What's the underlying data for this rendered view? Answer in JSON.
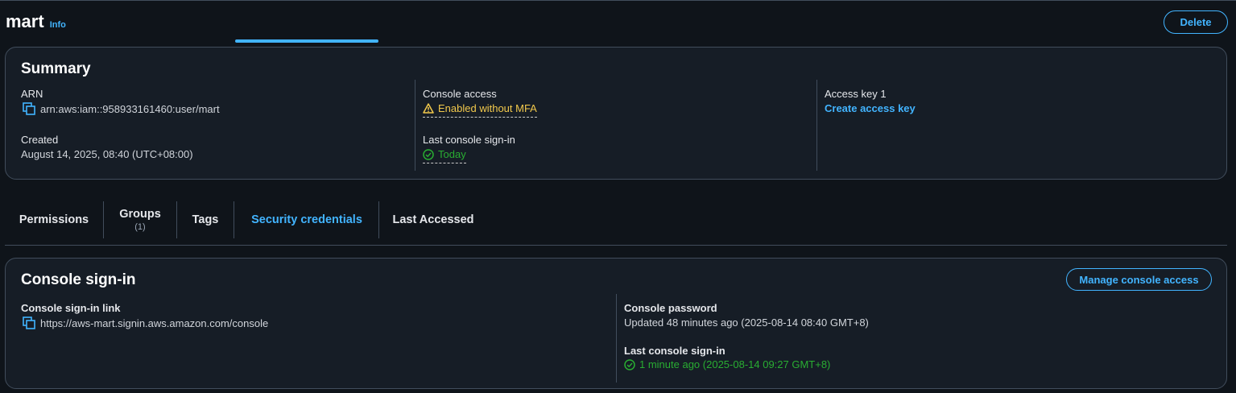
{
  "header": {
    "title": "mart",
    "info_label": "Info",
    "delete_label": "Delete"
  },
  "summary": {
    "title": "Summary",
    "arn_label": "ARN",
    "arn_value": "arn:aws:iam::958933161460:user/mart",
    "created_label": "Created",
    "created_value": "August 14, 2025, 08:40 (UTC+08:00)",
    "console_access_label": "Console access",
    "console_access_value": "Enabled without MFA",
    "last_signin_label": "Last console sign-in",
    "last_signin_value": "Today",
    "access_key_label": "Access key 1",
    "create_access_key_label": "Create access key"
  },
  "tabs": [
    {
      "label": "Permissions"
    },
    {
      "label": "Groups",
      "count": "(1)"
    },
    {
      "label": "Tags"
    },
    {
      "label": "Security credentials",
      "active": true
    },
    {
      "label": "Last Accessed"
    }
  ],
  "console_signin": {
    "title": "Console sign-in",
    "manage_label": "Manage console access",
    "link_label": "Console sign-in link",
    "link_value": "https://aws-mart.signin.aws.amazon.com/console",
    "password_label": "Console password",
    "password_value": "Updated 48 minutes ago (2025-08-14 08:40 GMT+8)",
    "last_signin_label": "Last console sign-in",
    "last_signin_value": "1 minute ago (2025-08-14 09:27 GMT+8)"
  },
  "colors": {
    "accent": "#42b4ff",
    "warning": "#f2c94c",
    "success": "#29ad32",
    "background": "#0f141a",
    "panel": "#161d26"
  },
  "icons": [
    "copy-icon",
    "warning-icon",
    "check-circle-icon"
  ]
}
